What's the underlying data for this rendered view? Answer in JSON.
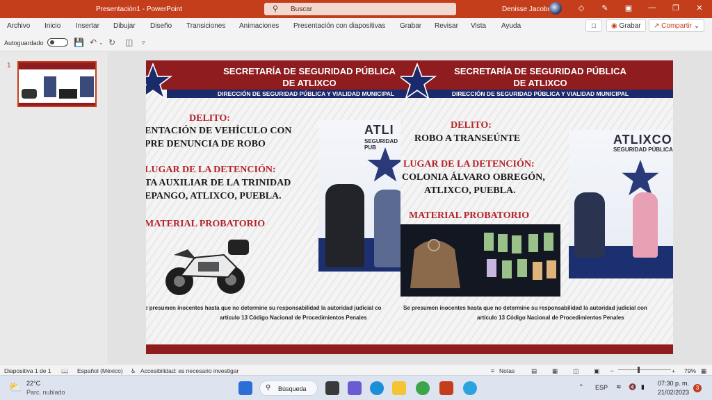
{
  "window": {
    "title": "Presentación1  -  PowerPoint",
    "search_placeholder": "Buscar",
    "user": "Denisse Jacobo"
  },
  "menu": {
    "items": [
      "Archivo",
      "Inicio",
      "Insertar",
      "Dibujar",
      "Diseño",
      "Transiciones",
      "Animaciones",
      "Presentación con diapositivas",
      "Grabar",
      "Revisar",
      "Vista",
      "Ayuda"
    ],
    "record_label": "Grabar",
    "share_label": "Compartir"
  },
  "qat": {
    "autosave_label": "Autoguardado"
  },
  "thumbnails": [
    {
      "number": "1"
    }
  ],
  "slide": {
    "posters": [
      {
        "header1": "SECRETARÍA DE SEGURIDAD PÚBLICA",
        "header2": "DE ATLIXCO",
        "subheader": "DIRECCIÓN DE SEGURIDAD PÚBLICA Y VIALIDAD MUNICIPAL",
        "delito_label": "DELITO:",
        "delito_line1": "ENTACIÓN DE VEHÍCULO CON",
        "delito_line2": "PRE DENUNCIA DE ROBO",
        "lugar_label": "LUGAR DE LA DETENCIÓN:",
        "lugar_line1": "TA AUXILIAR DE LA TRINIDAD",
        "lugar_line2": "EPANGO, ATLIXCO, PUEBLA.",
        "material_label": "MATERIAL PROBATORIO",
        "photo_brand": "ATLI",
        "photo_brand_sub": "SEGURIDAD PUB",
        "disclaimer1": "e presumen inocentes hasta que no determine su responsabilidad la autoridad judicial co",
        "disclaimer2": "artículo 13 Código Nacional de Procedimientos Penales"
      },
      {
        "header1": "SECRETARÍA DE SEGURIDAD PÚBLICA",
        "header2": "DE ATLIXCO",
        "subheader": "DIRECCIÓN DE SEGURIDAD PÚBLICA Y VIALIDAD MUNICIPAL",
        "delito_label": "DELITO:",
        "delito_line1": "ROBO A TRANSEÚNTE",
        "lugar_label": "LUGAR DE LA DETENCIÓN:",
        "lugar_line1": "COLONIA ÁLVARO OBREGÓN,",
        "lugar_line2": "ATLIXCO, PUEBLA.",
        "material_label": "MATERIAL PROBATORIO",
        "photo_brand": "ATLIXCO",
        "photo_brand_sub": "SEGURIDAD PÚBLICA",
        "disclaimer1": "Se presumen inocentes hasta que no determine su responsabilidad la autoridad judicial con",
        "disclaimer2": "artículo 13 Código Nacional de Procedimientos Penales"
      }
    ]
  },
  "status": {
    "slide_info": "Diapositiva 1 de 1",
    "language": "Español (México)",
    "accessibility": "Accesibilidad: es necesario investigar",
    "notes": "Notas",
    "zoom": "79%"
  },
  "taskbar": {
    "temperature": "22°C",
    "weather": "Parc. nublado",
    "search_label": "Búsqueda",
    "lang": "ESP",
    "time": "07:30 p. m.",
    "date": "21/02/2023",
    "notif_count": "3"
  },
  "colors": {
    "accent": "#c43e1c",
    "header_red": "#8f1c1f",
    "header_blue": "#1b2a6a"
  }
}
